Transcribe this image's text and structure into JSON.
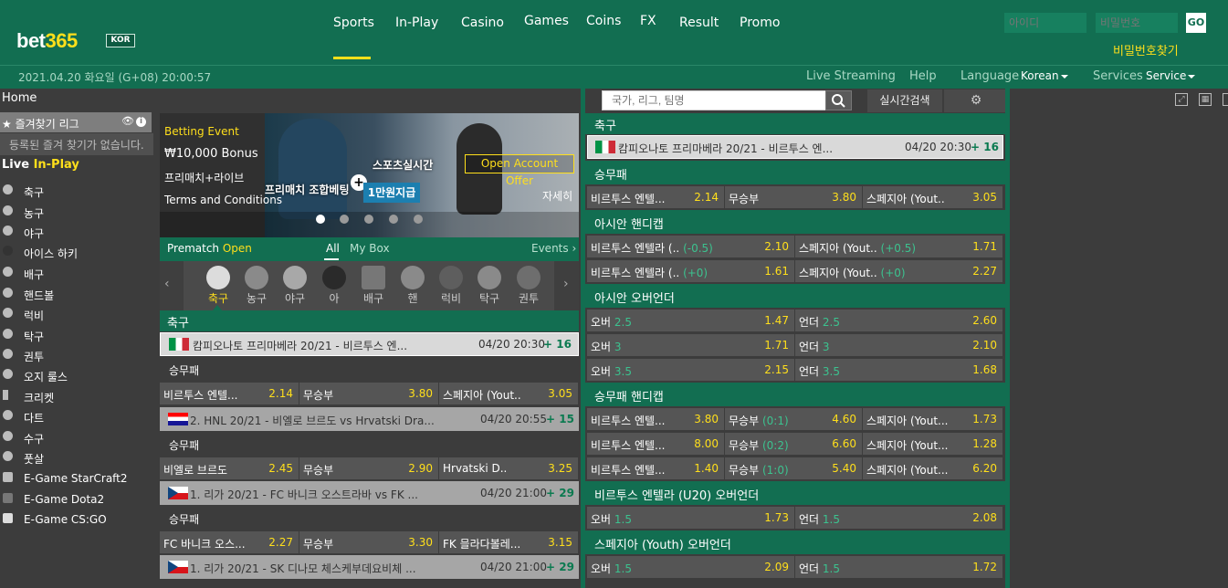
{
  "brand": {
    "name_a": "bet",
    "name_b": "365",
    "region": "KOR"
  },
  "nav": {
    "items": [
      "Sports",
      "In-Play",
      "Casino",
      "Games",
      "Coins",
      "FX",
      "Result",
      "Promo"
    ],
    "active": "Sports"
  },
  "login": {
    "id_placeholder": "아이디",
    "pw_placeholder": "비밀번호",
    "go_label": "GO",
    "find_pw": "비밀번호찾기"
  },
  "subbar": {
    "datetime": "2021.04.20 화요일 (G+08) 20:00:57",
    "live_streaming": "Live Streaming",
    "help": "Help",
    "language_label": "Language",
    "language_value": "Korean",
    "services_label": "Services",
    "service_value": "Service"
  },
  "sidebar": {
    "home": "Home",
    "favorites_title": "즐겨찾기 리그",
    "favorites_empty": "등록된 즐겨 찾기가 없습니다.",
    "live_a": "Live",
    "live_b": "In-Play",
    "sports": [
      "축구",
      "농구",
      "야구",
      "아이스 하키",
      "배구",
      "핸드볼",
      "럭비",
      "탁구",
      "권투",
      "오지 룰스",
      "크리켓",
      "다트",
      "수구",
      "풋살",
      "E-Game StarCraft2",
      "E-Game Dota2",
      "E-Game CS:GO"
    ]
  },
  "search": {
    "placeholder": "국가, 리그, 팀명",
    "live_search": "실시간검색"
  },
  "banner": {
    "event": "Betting Event",
    "bonus": "₩10,000 Bonus",
    "subtitle": "프리매치+라이브",
    "terms": "Terms and Conditions",
    "promo1": "프리매치 조합베팅",
    "promo2": "스포츠실시간",
    "badge": "1만원지급",
    "offer": "Open Account Offer",
    "detail": "자세히"
  },
  "tabs": {
    "prematch_a": "Prematch",
    "prematch_b": "Open",
    "all": "All",
    "mybox": "My Box",
    "events": "Events ›"
  },
  "sport_strip": [
    "축구",
    "농구",
    "야구",
    "아",
    "배구",
    "핸",
    "럭비",
    "탁구",
    "권투"
  ],
  "mid": {
    "section": "축구",
    "matches": [
      {
        "title": "캄피오나토 프리마베라 20/21 - 비르투스 엔...",
        "time": "04/20 20:30",
        "count": "+ 16",
        "market": "승무패",
        "odds": [
          {
            "name": "비르투스 엔텔...",
            "odd": "2.14"
          },
          {
            "name": "무승부",
            "odd": "3.80"
          },
          {
            "name": "스페지아 (Yout..",
            "odd": "3.05"
          }
        ]
      },
      {
        "title": "2. HNL 20/21 - 비엘로 브르도 vs Hrvatski Dra...",
        "time": "04/20 20:55",
        "count": "+ 15",
        "market": "승무패",
        "odds": [
          {
            "name": "비엘로 브르도",
            "odd": "2.45"
          },
          {
            "name": "무승부",
            "odd": "2.90"
          },
          {
            "name": "Hrvatski D..",
            "odd": "3.25"
          }
        ]
      },
      {
        "title": "1. 리가 20/21 - FC 바니크 오스트라바 vs FK ...",
        "time": "04/20 21:00",
        "count": "+ 29",
        "market": "승무패",
        "odds": [
          {
            "name": "FC 바니크 오스...",
            "odd": "2.27"
          },
          {
            "name": "무승부",
            "odd": "3.30"
          },
          {
            "name": "FK 믈라다볼레...",
            "odd": "3.15"
          }
        ]
      },
      {
        "title": "1. 리가 20/21 - SK 디나모 체스케부데요비체 ...",
        "time": "04/20 21:00",
        "count": "+ 29"
      }
    ]
  },
  "right": {
    "section": "축구",
    "match_title": "캄피오나토 프리마베라 20/21 - 비르투스 엔...",
    "match_time": "04/20 20:30",
    "match_count": "+ 16",
    "m1": {
      "title": "승무패",
      "rows": [
        [
          {
            "n": "비르투스 엔텔...",
            "o": "2.14"
          },
          {
            "n": "무승부",
            "o": "3.80"
          },
          {
            "n": "스페지아 (Yout..",
            "o": "3.05"
          }
        ]
      ]
    },
    "m2": {
      "title": "아시안 핸디캡",
      "rows": [
        [
          {
            "n": "비르투스 엔텔라 (..",
            "h": "(-0.5)",
            "o": "2.10"
          },
          {
            "n": "스페지아 (Yout..",
            "h": "(+0.5)",
            "o": "1.71"
          }
        ],
        [
          {
            "n": "비르투스 엔텔라 (..",
            "h": "(+0)",
            "o": "1.61"
          },
          {
            "n": "스페지아 (Yout..",
            "h": "(+0)",
            "o": "2.27"
          }
        ]
      ]
    },
    "m3": {
      "title": "아시안 오버언더",
      "rows": [
        [
          {
            "n": "오버",
            "h": "2.5",
            "o": "1.47"
          },
          {
            "n": "언더",
            "h": "2.5",
            "o": "2.60"
          }
        ],
        [
          {
            "n": "오버",
            "h": "3",
            "o": "1.71"
          },
          {
            "n": "언더",
            "h": "3",
            "o": "2.10"
          }
        ],
        [
          {
            "n": "오버",
            "h": "3.5",
            "o": "2.15"
          },
          {
            "n": "언더",
            "h": "3.5",
            "o": "1.68"
          }
        ]
      ]
    },
    "m4": {
      "title": "승무패 핸디캡",
      "rows": [
        [
          {
            "n": "비르투스 엔텔...",
            "o": "3.80"
          },
          {
            "n": "무승부",
            "h": "(0:1)",
            "o": "4.60"
          },
          {
            "n": "스페지아 (Yout...",
            "o": "1.73"
          }
        ],
        [
          {
            "n": "비르투스 엔텔...",
            "o": "8.00"
          },
          {
            "n": "무승부",
            "h": "(0:2)",
            "o": "6.60"
          },
          {
            "n": "스페지아 (Yout...",
            "o": "1.28"
          }
        ],
        [
          {
            "n": "비르투스 엔텔...",
            "o": "1.40"
          },
          {
            "n": "무승부",
            "h": "(1:0)",
            "o": "5.40"
          },
          {
            "n": "스페지아 (Yout...",
            "o": "6.20"
          }
        ]
      ]
    },
    "m5": {
      "title": "비르투스 엔텔라 (U20) 오버언더",
      "rows": [
        [
          {
            "n": "오버",
            "h": "1.5",
            "o": "1.73"
          },
          {
            "n": "언더",
            "h": "1.5",
            "o": "2.08"
          }
        ]
      ]
    },
    "m6": {
      "title": "스페지아 (Youth) 오버언더",
      "rows": [
        [
          {
            "n": "오버",
            "h": "1.5",
            "o": "2.09"
          },
          {
            "n": "언더",
            "h": "1.5",
            "o": "1.72"
          }
        ]
      ]
    }
  },
  "colors": {
    "brand_green": "#126e51",
    "accent_yellow": "#ffdf1b",
    "odds_green": "#3cc28f"
  }
}
